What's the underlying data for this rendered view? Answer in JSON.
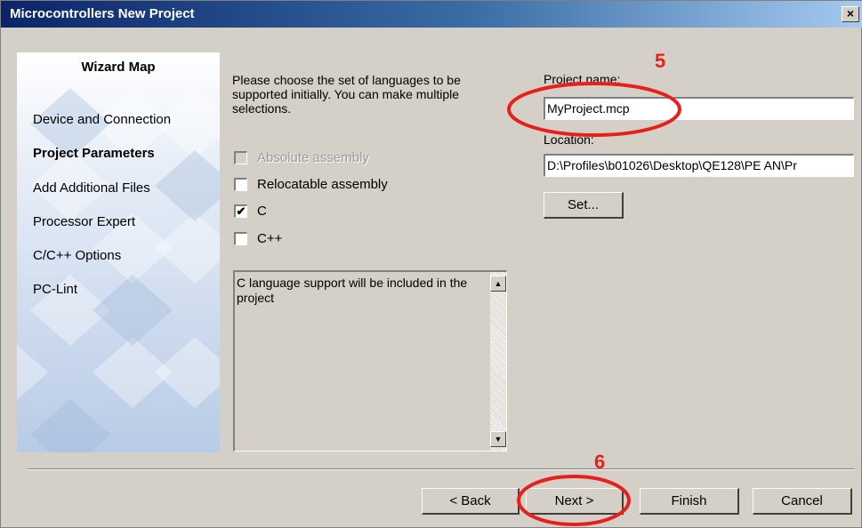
{
  "window": {
    "title": "Microcontrollers New Project",
    "close_glyph": "×"
  },
  "wizard_map": {
    "title": "Wizard Map",
    "items": [
      {
        "label": "Device and Connection",
        "current": false
      },
      {
        "label": "Project Parameters",
        "current": true
      },
      {
        "label": "Add Additional Files",
        "current": false
      },
      {
        "label": "Processor Expert",
        "current": false
      },
      {
        "label": "C/C++ Options",
        "current": false
      },
      {
        "label": "PC-Lint",
        "current": false
      }
    ]
  },
  "languages": {
    "description": "Please choose the set of languages to be supported initially. You can make multiple selections.",
    "options": [
      {
        "label": "Absolute assembly",
        "checked": false,
        "enabled": false
      },
      {
        "label": "Relocatable assembly",
        "checked": false,
        "enabled": true
      },
      {
        "label": "C",
        "checked": true,
        "enabled": true
      },
      {
        "label": "C++",
        "checked": false,
        "enabled": true
      }
    ],
    "info_text": "C language support will be included in the project"
  },
  "project": {
    "name_label": "Project name:",
    "name_value": "MyProject.mcp",
    "location_label": "Location:",
    "location_value": "D:\\Profiles\\b01026\\Desktop\\QE128\\PE AN\\Pr",
    "set_button": "Set..."
  },
  "buttons": {
    "back": "< Back",
    "next": "Next >",
    "finish": "Finish",
    "cancel": "Cancel"
  },
  "annotations": {
    "step_5": "5",
    "step_6": "6",
    "color": "#e8201c"
  },
  "icons": {
    "checkmark": "✔",
    "scroll_up": "▲",
    "scroll_down": "▼"
  }
}
